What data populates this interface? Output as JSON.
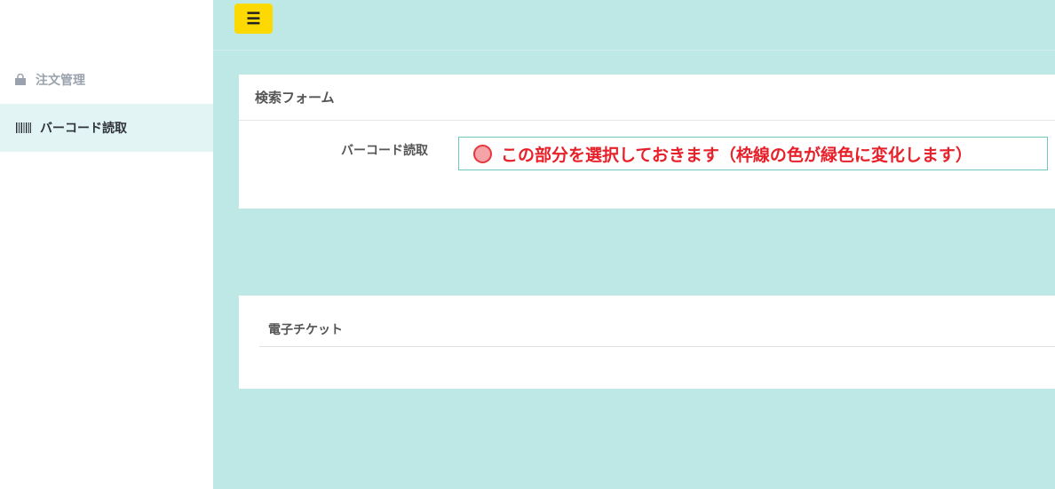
{
  "topbar": {
    "menu_icon": "☰"
  },
  "sidebar": {
    "items": [
      {
        "label": "注文管理",
        "icon": "shopping-bag-icon"
      },
      {
        "label": "バーコード読取",
        "icon": "barcode-icon",
        "active": true
      }
    ]
  },
  "search_form": {
    "title": "検索フォーム",
    "barcode_label": "バーコード読取",
    "annotation": "この部分を選択しておきます（枠線の色が緑色に変化します）"
  },
  "ticket": {
    "title": "電子チケット"
  },
  "colors": {
    "main_bg": "#bde8e6",
    "menu_button": "#fcd900",
    "active_item_bg": "#e2f4f4",
    "input_border": "#6fc6bd",
    "annotation_red": "#e8202a"
  }
}
